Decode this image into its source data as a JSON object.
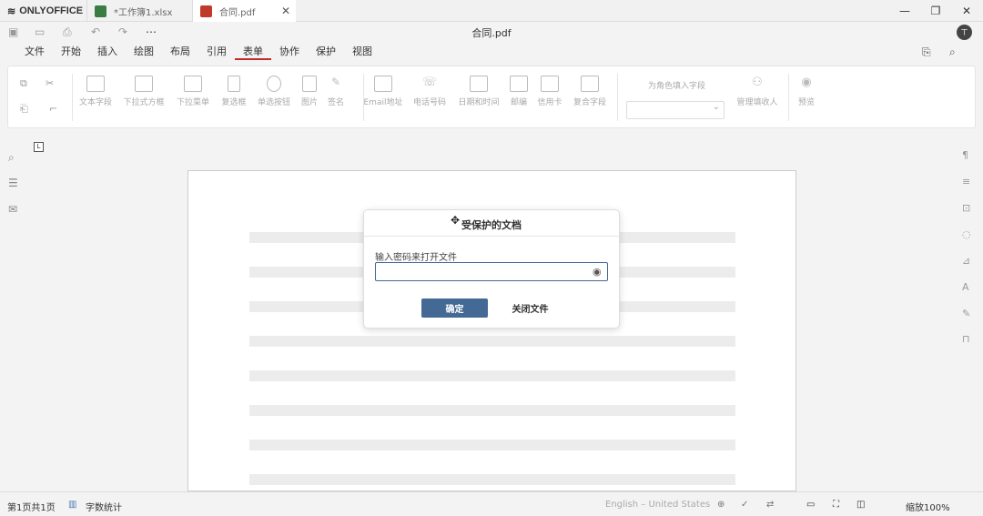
{
  "app": {
    "brand": "ONLYOFFICE"
  },
  "tabs": [
    {
      "label": "*工作簿1.xlsx",
      "color": "#3a7d44",
      "active": false
    },
    {
      "label": "合同.pdf",
      "color": "#c0392b",
      "active": true
    }
  ],
  "document": {
    "title": "合同.pdf",
    "avatar": "ㄒ"
  },
  "menu": [
    "文件",
    "开始",
    "插入",
    "绘图",
    "布局",
    "引用",
    "表单",
    "协作",
    "保护",
    "视图"
  ],
  "ribbon": {
    "buttons": [
      "文本字段",
      "下拉式方框",
      "下拉菜单",
      "复选框",
      "单选按钮",
      "图片",
      "签名",
      "Email地址",
      "电话号码",
      "日期和时间",
      "邮编",
      "信用卡",
      "复合字段"
    ],
    "role_label": "为角色填入字段",
    "manage_roles": "管理填收人",
    "preview": "预览"
  },
  "dialog": {
    "title": "受保护的文档",
    "label": "输入密码来打开文件",
    "password_value": "",
    "ok": "确定",
    "close": "关闭文件"
  },
  "status": {
    "page": "第1页共1页",
    "word_count": "字数统计",
    "language": "English – United States",
    "zoom": "缩放100%"
  },
  "colors": {
    "accent": "#446995",
    "active_tab_underline": "#c42c2c"
  }
}
